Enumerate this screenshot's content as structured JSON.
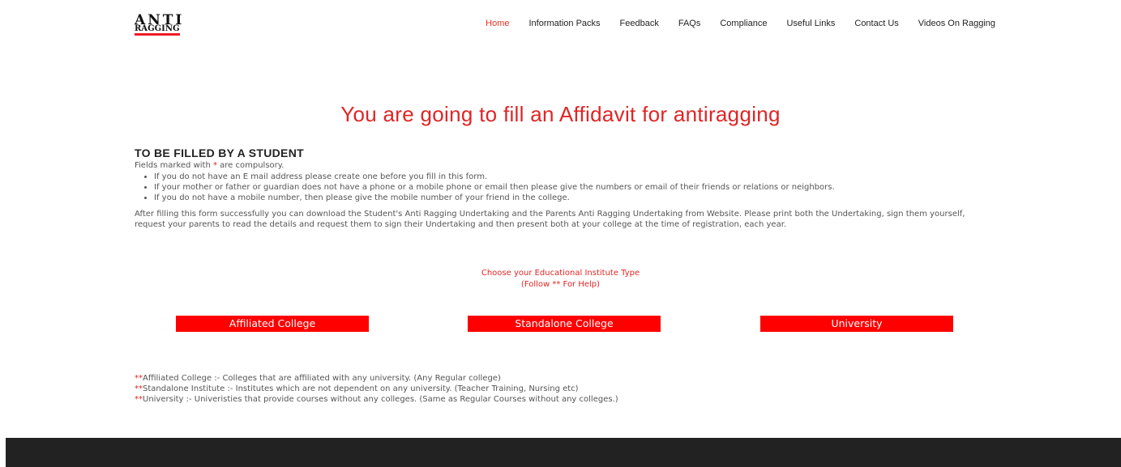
{
  "logo": {
    "top": "ANTI",
    "bottom": "RAGGING"
  },
  "nav": [
    {
      "label": "Home",
      "active": true
    },
    {
      "label": "Information Packs",
      "active": false
    },
    {
      "label": "Feedback",
      "active": false
    },
    {
      "label": "FAQs",
      "active": false
    },
    {
      "label": "Compliance",
      "active": false
    },
    {
      "label": "Useful Links",
      "active": false
    },
    {
      "label": "Contact Us",
      "active": false
    },
    {
      "label": "Videos On Ragging",
      "active": false
    }
  ],
  "page_title": "You are going to fill an Affidavit for antiragging",
  "section": {
    "heading": "TO BE FILLED BY A STUDENT",
    "fields_note_prefix": "Fields marked with ",
    "required_marker": "*",
    "fields_note_suffix": " are compulsory.",
    "rules": [
      "If you do not have an E mail address please create one before you fill in this form.",
      "If your mother or father or guardian does not have a phone or a mobile phone or email then please give the numbers or email of their friends or relations or neighbors.",
      "If you do not have a mobile number, then please give the mobile number of your friend in the college."
    ],
    "paragraph": "After filling this form successfully you can download the Student's Anti Ragging Undertaking and the Parents Anti Ragging Undertaking from Website. Please print both the Undertaking, sign them yourself, request your parents to read the details and request them to sign their Undertaking and then present both at your college at the time of registration, each year."
  },
  "choose": {
    "line1": "Choose your Educational Institute Type",
    "line2": "(Follow ** For Help)"
  },
  "buttons": {
    "affiliated": "Affiliated College",
    "standalone": "Standalone College",
    "university": "University"
  },
  "notes": [
    {
      "marker": "**",
      "text": "Affiliated College :- Colleges that are affiliated with any university. (Any Regular college)"
    },
    {
      "marker": "**",
      "text": "Standalone Institute :- Institutes which are not dependent on any university. (Teacher Training, Nursing etc)"
    },
    {
      "marker": "**",
      "text": "University :- Univeristies that provide courses without any colleges. (Same as Regular Courses without any colleges.)"
    }
  ],
  "colors": {
    "accent": "#e02525",
    "button": "#ff0000",
    "footer": "#222222"
  }
}
